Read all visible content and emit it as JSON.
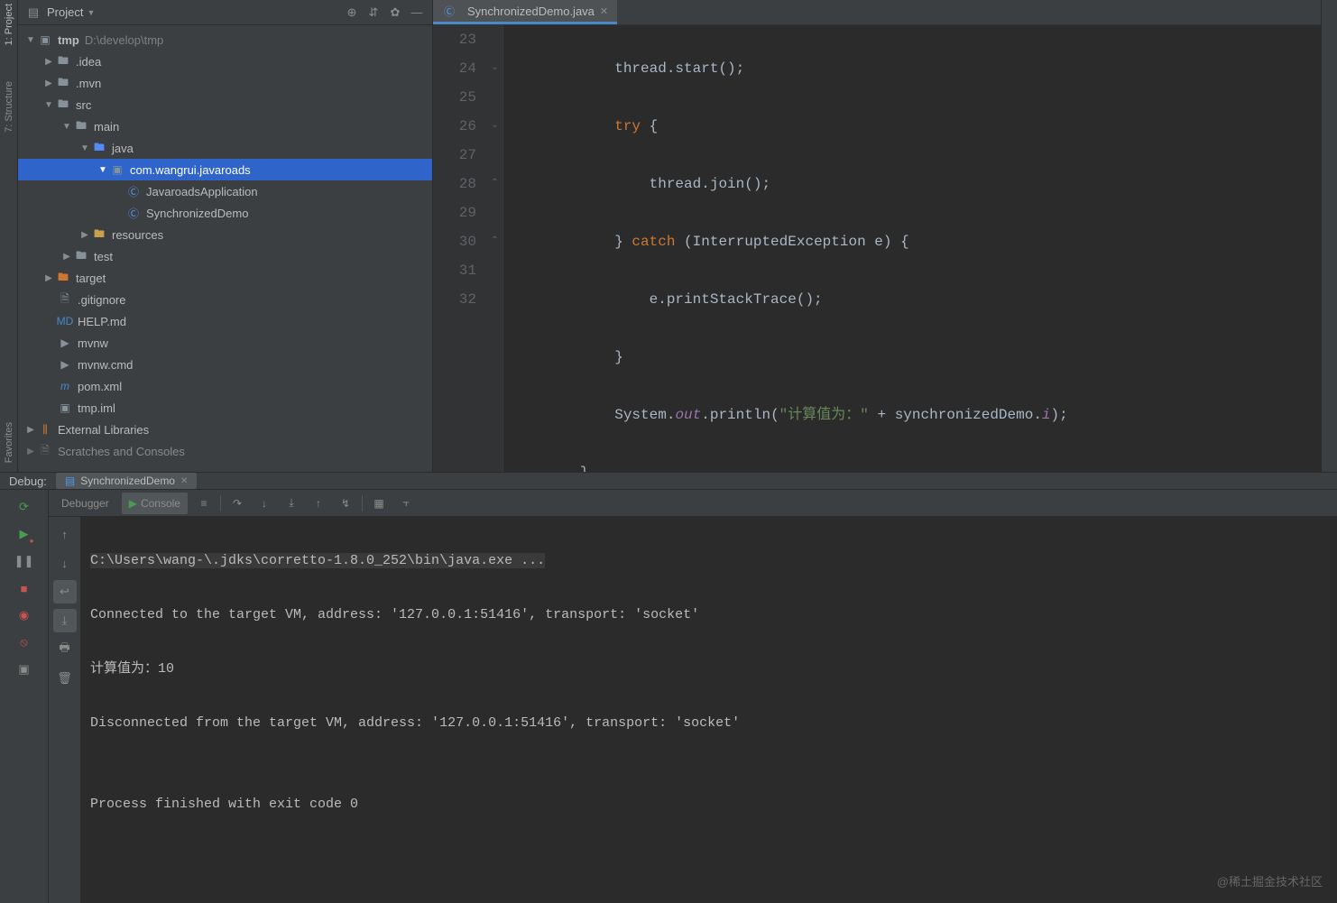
{
  "sidebar": {
    "tabs": {
      "project": "1: Project",
      "structure": "7: Structure",
      "favorites": "Favorites"
    }
  },
  "project": {
    "title": "Project",
    "root": {
      "name": "tmp",
      "path": "D:\\develop\\tmp"
    },
    "tree": {
      "idea": ".idea",
      "mvn": ".mvn",
      "src": "src",
      "main": "main",
      "java": "java",
      "pkg": "com.wangrui.javaroads",
      "cls1": "JavaroadsApplication",
      "cls2": "SynchronizedDemo",
      "resources": "resources",
      "test": "test",
      "target": "target",
      "gitignore": ".gitignore",
      "help": "HELP.md",
      "mvnw": "mvnw",
      "mvnwcmd": "mvnw.cmd",
      "pom": "pom.xml",
      "tmpiml": "tmp.iml",
      "extlib": "External Libraries",
      "scratches": "Scratches and Consoles"
    }
  },
  "editor": {
    "tab": "SynchronizedDemo.java",
    "lines": {
      "l23": {
        "n": "23",
        "indent": "            ",
        "pre": "thread.start();",
        "code": "thread.start();"
      },
      "l24": {
        "n": "24",
        "indent": "            ",
        "kw": "try",
        "rest": " {"
      },
      "l25": {
        "n": "25",
        "indent": "                ",
        "code": "thread.join();"
      },
      "l26": {
        "n": "26",
        "indent": "            ",
        "pre": "} ",
        "kw": "catch",
        "rest": " (InterruptedException e) {"
      },
      "l27": {
        "n": "27",
        "indent": "                ",
        "code": "e.printStackTrace();"
      },
      "l28": {
        "n": "28",
        "indent": "            ",
        "code": "}"
      },
      "l29": {
        "n": "29",
        "indent": "            ",
        "a": "System.",
        "b": "out",
        "c": ".println(",
        "str": "\"计算值为：\"",
        "d": " + synchronizedDemo.",
        "f": "i",
        "e": ");"
      },
      "l30": {
        "n": "30",
        "indent": "        ",
        "code": "}"
      },
      "l31": {
        "n": "31",
        "indent": "    ",
        "code": "}"
      },
      "l32": {
        "n": "32",
        "code": ""
      }
    }
  },
  "debug": {
    "label": "Debug:",
    "run_config": "SynchronizedDemo",
    "debugger_tab": "Debugger",
    "console_tab": "Console",
    "output": {
      "cmd": "C:\\Users\\wang-\\.jdks\\corretto-1.8.0_252\\bin\\java.exe ...",
      "line2": "Connected to the target VM, address: '127.0.0.1:51416', transport: 'socket'",
      "line3": "计算值为：10",
      "line4": "Disconnected from the target VM, address: '127.0.0.1:51416', transport: 'socket'",
      "line5": "",
      "line6": "Process finished with exit code 0"
    }
  },
  "watermark": "@稀土掘金技术社区"
}
